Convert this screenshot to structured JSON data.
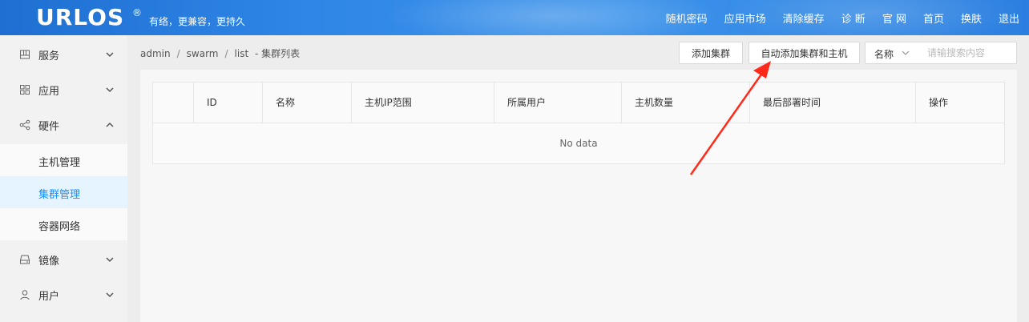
{
  "header": {
    "logo": "URLOS",
    "logo_mark": "®",
    "slogan": "有络，更兼容，更持久",
    "nav": [
      "随机密码",
      "应用市场",
      "清除缓存",
      "诊 断",
      "官 网",
      "首页",
      "换肤",
      "退出"
    ]
  },
  "sidebar": {
    "items": [
      {
        "label": "服务",
        "icon": "service-icon",
        "expanded": false
      },
      {
        "label": "应用",
        "icon": "apps-grid-icon",
        "expanded": false
      },
      {
        "label": "硬件",
        "icon": "share-nodes-icon",
        "expanded": true
      },
      {
        "label": "镜像",
        "icon": "drive-icon",
        "expanded": false
      },
      {
        "label": "用户",
        "icon": "user-icon",
        "expanded": false
      }
    ],
    "submenu": [
      {
        "label": "主机管理",
        "active": false
      },
      {
        "label": "集群管理",
        "active": true
      },
      {
        "label": "容器网络",
        "active": false
      }
    ]
  },
  "breadcrumb": {
    "parts": [
      "admin",
      "swarm",
      "list"
    ],
    "separator": "/",
    "title": "-  集群列表"
  },
  "toolbar": {
    "add_cluster": "添加集群",
    "auto_add": "自动添加集群和主机",
    "search_field": "名称",
    "search_placeholder": "请输搜索内容"
  },
  "table": {
    "columns": [
      "",
      "ID",
      "名称",
      "主机IP范围",
      "所属用户",
      "主机数量",
      "最后部署时间",
      "操作"
    ],
    "empty_text": "No data"
  },
  "colors": {
    "header_blue": "#2f86e6",
    "active_text": "#1890ff",
    "active_bg": "#e6f4ff",
    "annotation_arrow": "#ff2a1a"
  }
}
